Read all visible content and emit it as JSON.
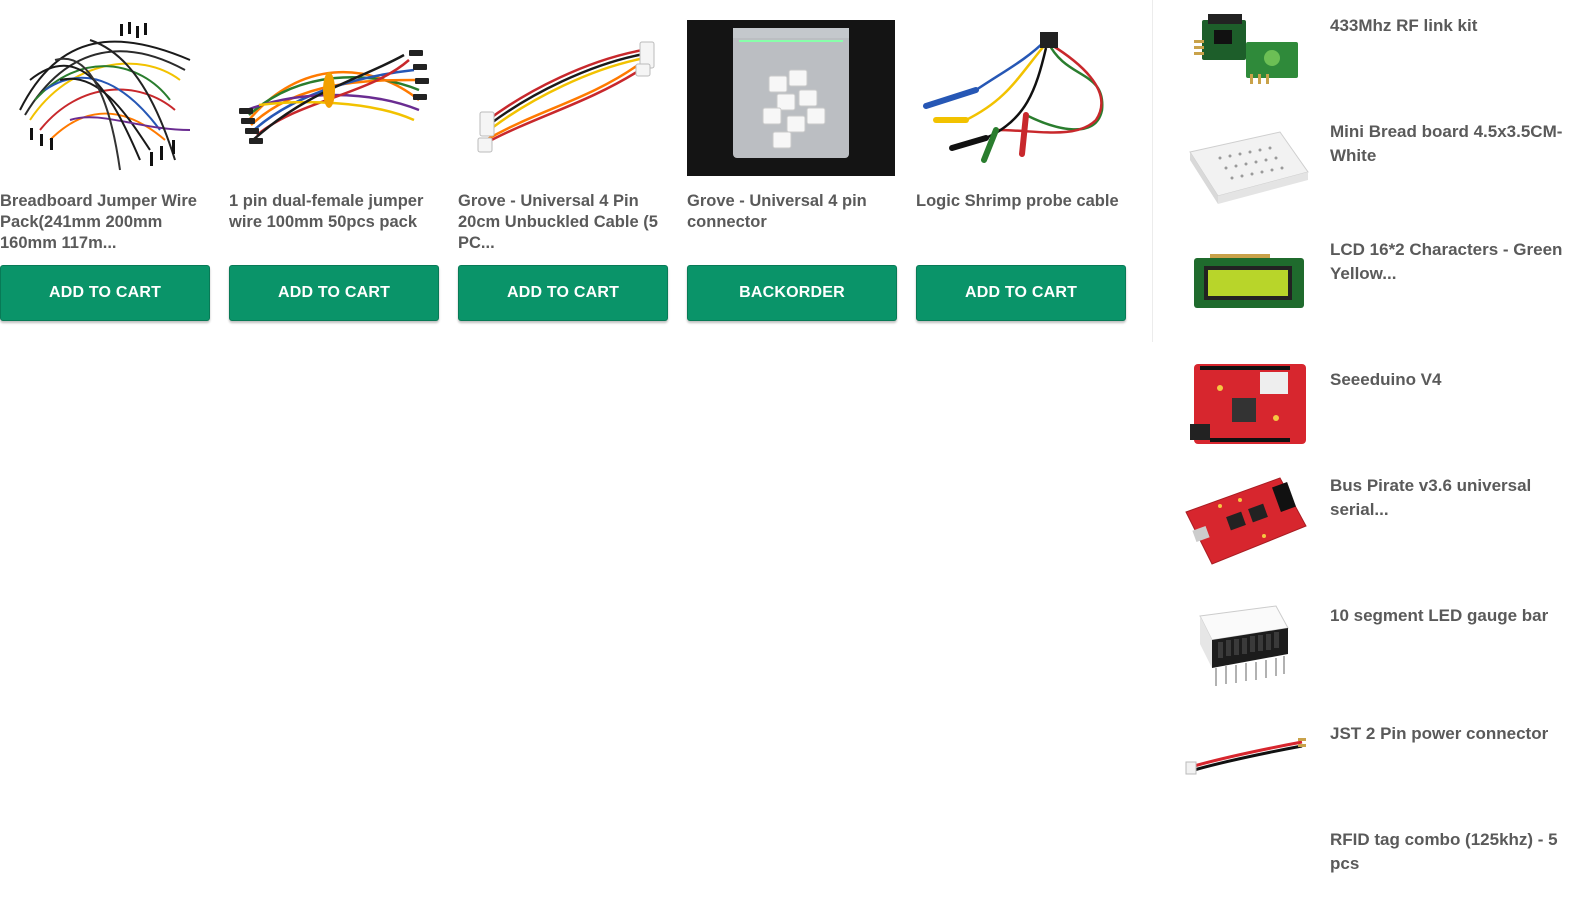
{
  "products": [
    {
      "title": "Breadboard Jumper Wire Pack(241mm 200mm 160mm 117m...",
      "button": "ADD TO CART",
      "image": "jumper-wire-pack-image"
    },
    {
      "title": "1 pin dual-female jumper wire 100mm 50pcs pack",
      "button": "ADD TO CART",
      "image": "dual-female-jumper-image"
    },
    {
      "title": "Grove - Universal 4 Pin 20cm Unbuckled Cable (5 PC...",
      "button": "ADD TO CART",
      "image": "grove-cable-image"
    },
    {
      "title": "Grove - Universal 4 pin connector",
      "button": "BACKORDER",
      "image": "grove-connector-image"
    },
    {
      "title": "Logic Shrimp probe cable",
      "button": "ADD TO CART",
      "image": "probe-cable-image"
    }
  ],
  "sidebar": {
    "items": [
      {
        "label": "433Mhz RF link kit",
        "image": "rf-link-kit-image"
      },
      {
        "label": "Mini Bread board 4.5x3.5CM-White",
        "image": "mini-breadboard-image"
      },
      {
        "label": "LCD 16*2 Characters - Green Yellow...",
        "image": "lcd-image"
      },
      {
        "label": "Seeeduino V4",
        "image": "seeeduino-image"
      },
      {
        "label": "Bus Pirate v3.6 universal serial...",
        "image": "bus-pirate-image"
      },
      {
        "label": "10 segment LED gauge bar",
        "image": "led-bar-image"
      },
      {
        "label": "JST 2 Pin power connector",
        "image": "jst-connector-image"
      },
      {
        "label": "RFID tag combo (125khz) - 5 pcs",
        "image": "rfid-tag-image"
      }
    ]
  },
  "colors": {
    "button": "#0a9469",
    "button_text": "#ffffff",
    "title_text": "#5a5a5a",
    "divider": "#ececec"
  }
}
